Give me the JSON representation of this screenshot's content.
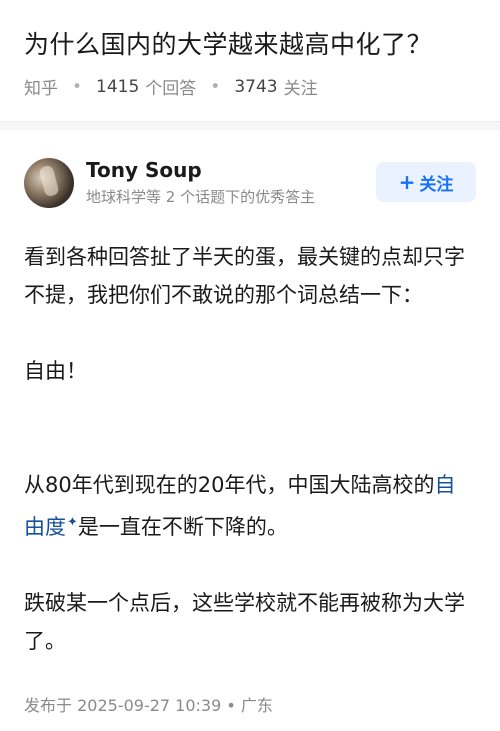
{
  "question": {
    "title": "为什么国内的大学越来越高中化了？",
    "source": "知乎",
    "answer_count": "1415",
    "answer_label": "个回答",
    "follower_count": "3743",
    "follower_label": "关注"
  },
  "answer": {
    "author_name": "Tony  Soup",
    "author_badge": "地球科学等 2 个话题下的优秀答主",
    "follow_button": "关注",
    "paragraphs": {
      "p1": "看到各种回答扯了半天的蛋，最关键的点却只字不提，我把你们不敢说的那个词总结一下：",
      "p2": "自由！",
      "p3_before": "从80年代到现在的20年代，中国大陆高校的",
      "p3_link": "自由度",
      "p3_after": "是一直在不断下降的。",
      "p4": "跌破某一个点后，这些学校就不能再被称为大学了。"
    },
    "publish_info": "发布于  2025-09-27  10:39 • 广东"
  },
  "icons": {
    "follow_plus": "plus-icon",
    "link_marker": "sparkle-icon"
  },
  "colors": {
    "accent": "#1772f6",
    "link": "#175199",
    "meta": "#8a8a8a"
  }
}
